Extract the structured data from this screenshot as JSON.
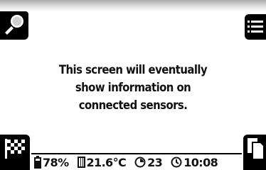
{
  "message": {
    "lines": [
      "This screen will eventually",
      "show information on",
      "connected sensors."
    ]
  },
  "corners": {
    "top_left_icon": "search-icon",
    "top_right_icon": "menu-list-icon",
    "bottom_left_icon": "checkered-flag-icon",
    "bottom_right_icon": "copy-pages-icon"
  },
  "status": {
    "battery": {
      "icon": "battery-icon",
      "value": "78%"
    },
    "temperature": {
      "icon": "thermometer-icon",
      "value": "21.6°C"
    },
    "count": {
      "icon": "timer-icon",
      "value": "23"
    },
    "clock": {
      "icon": "clock-icon",
      "value": "10:08"
    }
  },
  "colors": {
    "background": "#ffffff",
    "foreground": "#000000",
    "text": "#111111"
  }
}
